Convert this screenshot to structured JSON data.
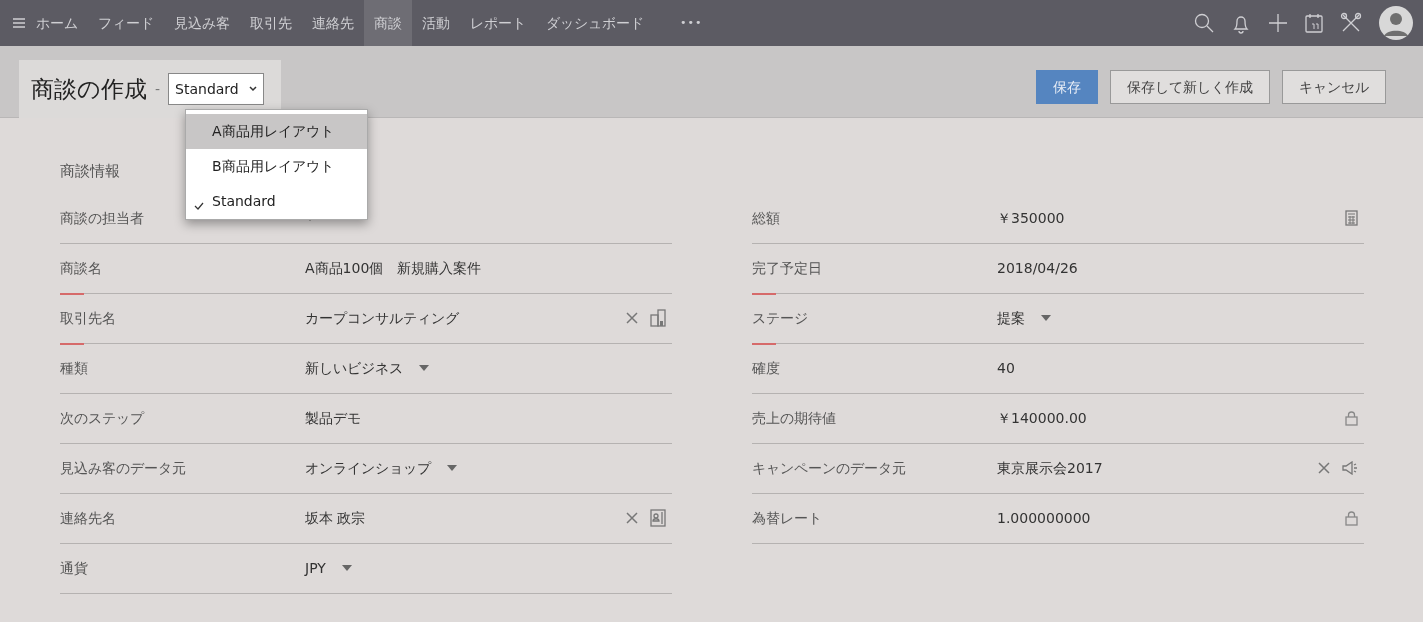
{
  "nav": {
    "items": [
      {
        "label": "ホーム",
        "selected": false
      },
      {
        "label": "フィード",
        "selected": false
      },
      {
        "label": "見込み客",
        "selected": false
      },
      {
        "label": "取引先",
        "selected": false
      },
      {
        "label": "連絡先",
        "selected": false
      },
      {
        "label": "商談",
        "selected": true
      },
      {
        "label": "活動",
        "selected": false
      },
      {
        "label": "レポート",
        "selected": false
      },
      {
        "label": "ダッシュボード",
        "selected": false
      }
    ],
    "more": "•••"
  },
  "header": {
    "title": "商談の作成",
    "separator": "-",
    "layout_select": {
      "value": "Standard",
      "options": [
        {
          "label": "A商品用レイアウト",
          "selected": false,
          "hovered": true
        },
        {
          "label": "B商品用レイアウト",
          "selected": false,
          "hovered": false
        },
        {
          "label": "Standard",
          "selected": true,
          "hovered": false
        }
      ]
    },
    "buttons": [
      {
        "label": "保存",
        "kind": "primary"
      },
      {
        "label": "保存して新しく作成",
        "kind": "secondary"
      },
      {
        "label": "キャンセル",
        "kind": "secondary"
      }
    ]
  },
  "section": {
    "title": "商談情報",
    "left_fields": [
      {
        "label": "商談の担当者",
        "kind": "select",
        "required": false
      },
      {
        "label": "商談名",
        "value": "A商品100個　新規購入案件",
        "kind": "text",
        "required": true
      },
      {
        "label": "取引先名",
        "value": "カープコンサルティング",
        "kind": "account",
        "required": true
      },
      {
        "label": "種類",
        "value": "新しいビジネス",
        "kind": "select",
        "required": false
      },
      {
        "label": "次のステップ",
        "value": "製品デモ",
        "kind": "text",
        "required": false
      },
      {
        "label": "見込み客のデータ元",
        "value": "オンラインショップ",
        "kind": "select",
        "required": false
      },
      {
        "label": "連絡先名",
        "value": "坂本 政宗",
        "kind": "contact",
        "required": false
      },
      {
        "label": "通貨",
        "value": "JPY",
        "kind": "select",
        "required": false
      }
    ],
    "right_fields": [
      {
        "label": "総額",
        "value": "￥350000",
        "kind": "calculated",
        "required": false
      },
      {
        "label": "完了予定日",
        "value": "2018/04/26",
        "kind": "text",
        "required": true
      },
      {
        "label": "ステージ",
        "value": "提案",
        "kind": "select",
        "required": true
      },
      {
        "label": "確度",
        "value": "40",
        "kind": "text",
        "required": false
      },
      {
        "label": "売上の期待値",
        "value": "￥140000.00",
        "kind": "locked",
        "required": false
      },
      {
        "label": "キャンペーンのデータ元",
        "value": "東京展示会2017",
        "kind": "campaign",
        "required": false
      },
      {
        "label": "為替レート",
        "value": "1.000000000",
        "kind": "locked",
        "required": false
      }
    ]
  }
}
